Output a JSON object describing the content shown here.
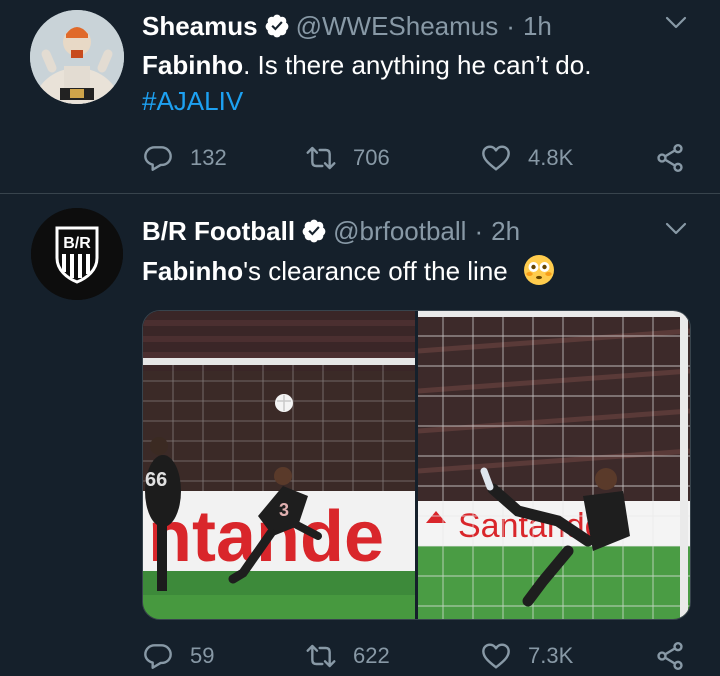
{
  "tweets": [
    {
      "name": "Sheamus",
      "handle": "@WWESheamus",
      "separator": "·",
      "time": "1h",
      "text_bold": "Fabinho",
      "text_rest": ". Is there anything he can’t do.",
      "hashtag": "#AJALIV",
      "replies": "132",
      "retweets": "706",
      "likes": "4.8K"
    },
    {
      "name": "B/R Football",
      "handle": "@brfootball",
      "separator": "·",
      "time": "2h",
      "text_bold": "Fabinho",
      "text_rest": "'s clearance off the line",
      "emoji": "flushed-face-emoji",
      "avatar_logo": "B/R",
      "photo_left_ad": "ntande",
      "photo_left_shirt_num": "3",
      "photo_left_other_num": "66",
      "photo_right_ad": "Santande",
      "replies": "59",
      "retweets": "622",
      "likes": "7.3K"
    }
  ],
  "colors": {
    "background": "#15202b",
    "secondary_text": "#8899a6",
    "link": "#1da1f2",
    "divider": "#38444d"
  },
  "icons": [
    "verified-icon",
    "chevron-down-icon",
    "reply-icon",
    "retweet-icon",
    "like-icon",
    "share-icon"
  ]
}
